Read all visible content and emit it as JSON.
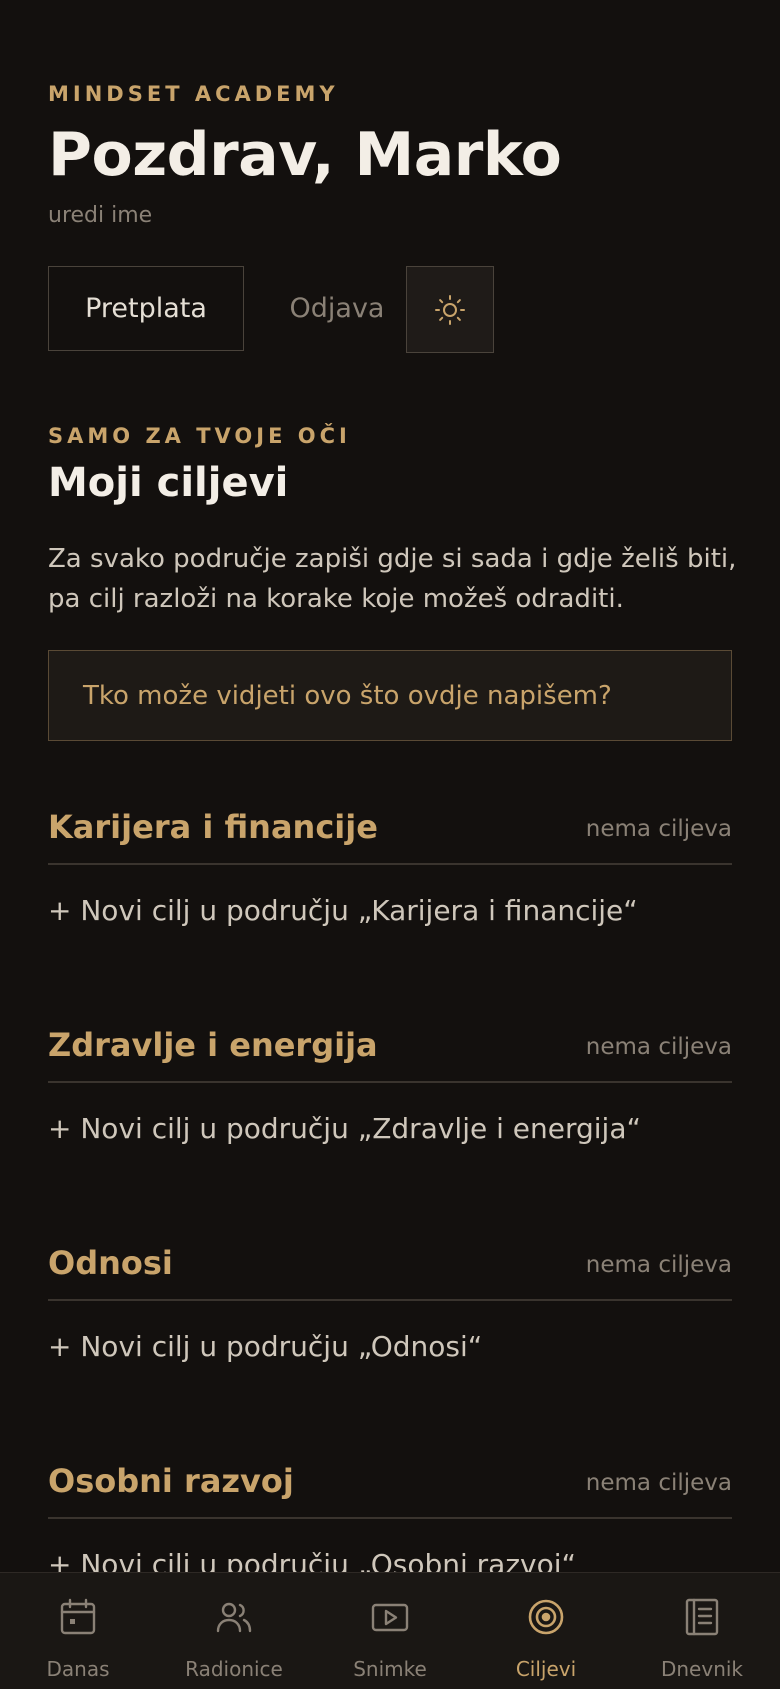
{
  "header": {
    "brand": "MINDSET ACADEMY",
    "greeting": "Pozdrav, Marko",
    "edit_name": "uredi ime",
    "subscription_label": "Pretplata",
    "logout_label": "Odjava",
    "theme_icon": "sun-icon"
  },
  "goals": {
    "eyebrow": "SAMO ZA TVOJE OČI",
    "title": "Moji ciljevi",
    "intro": "Za svako područje zapiši gdje si sada i gdje želiš biti, pa cilj razloži na korake koje možeš odraditi.",
    "privacy_question": "Tko može vidjeti ovo što ovdje napišem?",
    "areas": [
      {
        "title": "Karijera i financije",
        "count": "nema ciljeva",
        "add": "+ Novi cilj u području „Karijera i financije“"
      },
      {
        "title": "Zdravlje i energija",
        "count": "nema ciljeva",
        "add": "+ Novi cilj u području „Zdravlje i energija“"
      },
      {
        "title": "Odnosi",
        "count": "nema ciljeva",
        "add": "+ Novi cilj u području „Odnosi“"
      },
      {
        "title": "Osobni razvoj",
        "count": "nema ciljeva",
        "add": "+ Novi cilj u području „Osobni razvoj“"
      }
    ]
  },
  "tabbar": {
    "active": "Ciljevi",
    "accent_color": "#c9a46b",
    "tabs": [
      {
        "label": "Danas",
        "icon": "calendar-icon"
      },
      {
        "label": "Radionice",
        "icon": "people-icon"
      },
      {
        "label": "Snimke",
        "icon": "play-icon"
      },
      {
        "label": "Ciljevi",
        "icon": "target-icon"
      },
      {
        "label": "Dnevnik",
        "icon": "journal-icon"
      }
    ]
  }
}
